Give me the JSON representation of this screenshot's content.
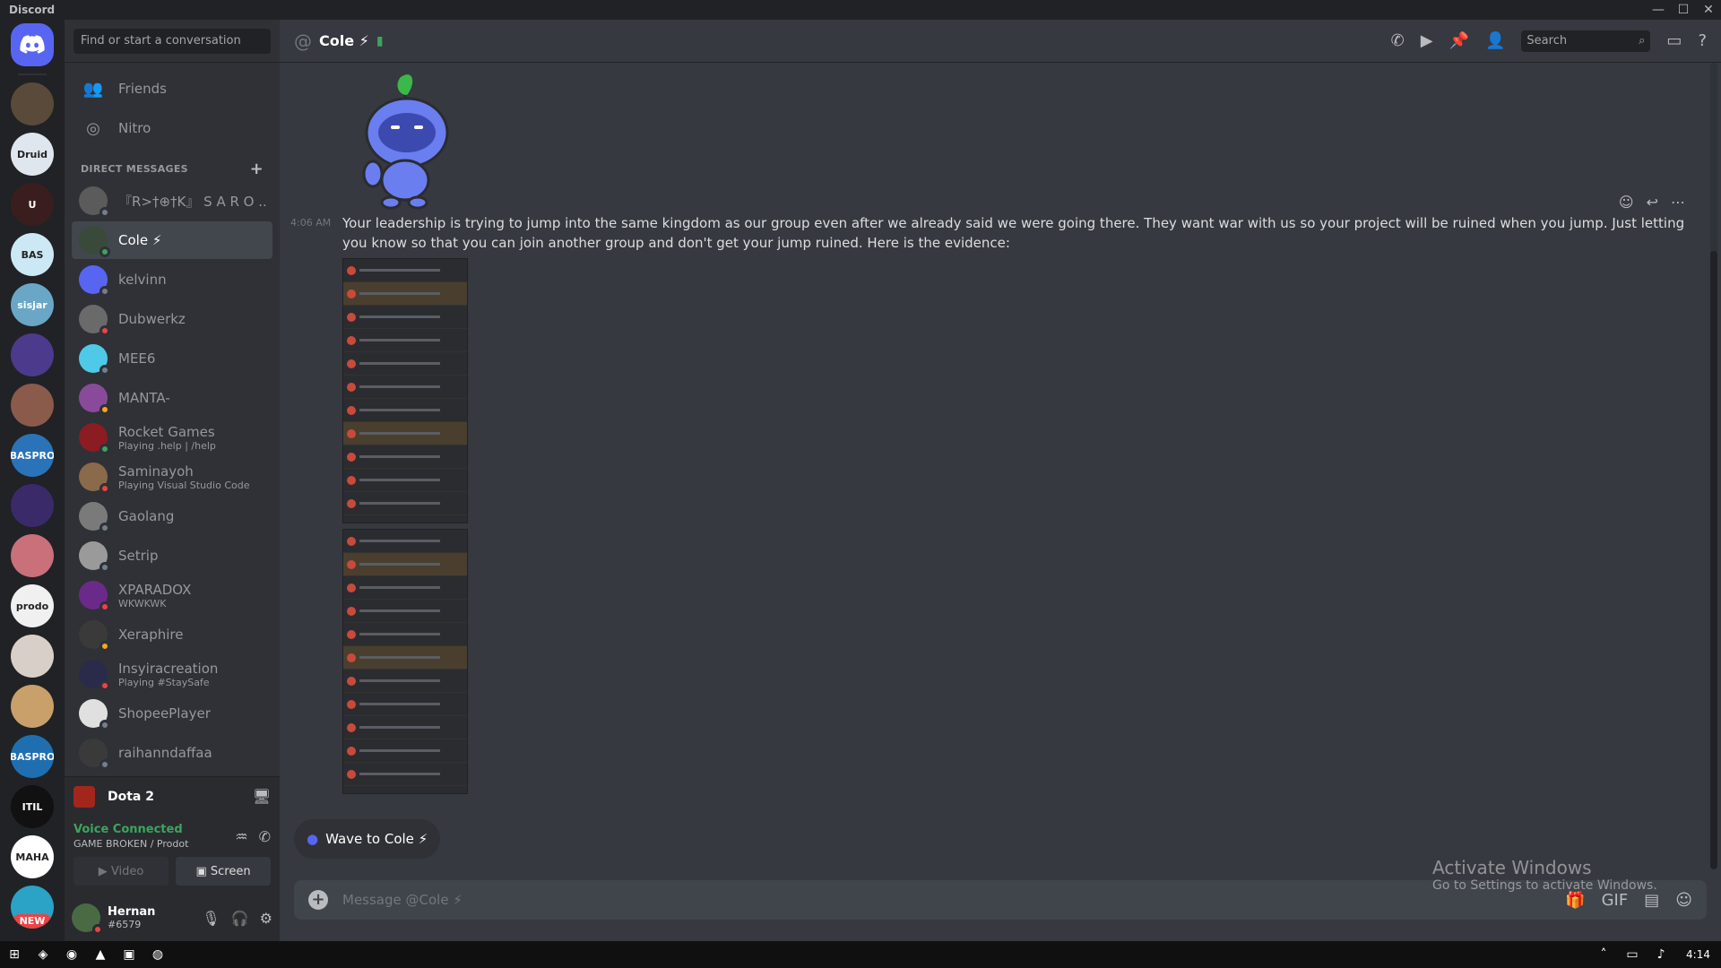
{
  "window": {
    "title": "Discord"
  },
  "guilds": [
    {
      "label": "",
      "color": "#5a4a3a"
    },
    {
      "label": "Druid",
      "color": "#dfe6ee"
    },
    {
      "label": "U",
      "color": "#3a1e1e"
    },
    {
      "label": "BAS",
      "color": "#cde8f5"
    },
    {
      "label": "sisjar",
      "color": "#6aa6c6"
    },
    {
      "label": "",
      "color": "#4c3a8c"
    },
    {
      "label": "",
      "color": "#8a5a4a"
    },
    {
      "label": "BASPRO",
      "color": "#2a73b8"
    },
    {
      "label": "",
      "color": "#3a2a6a"
    },
    {
      "label": "",
      "color": "#c9707a"
    },
    {
      "label": "prodo",
      "color": "#f0f0f0"
    },
    {
      "label": "",
      "color": "#d8d0c8"
    },
    {
      "label": "",
      "color": "#c9a06a"
    },
    {
      "label": "BASPRO",
      "color": "#1f6fb0"
    },
    {
      "label": "ITIL",
      "color": "#111111"
    },
    {
      "label": "MAHA",
      "color": "#ffffff"
    },
    {
      "label": "NEW",
      "color": "#2aa3c7"
    }
  ],
  "sidebar": {
    "search_placeholder": "Find or start a conversation",
    "nav": [
      {
        "label": "Friends",
        "icon": "friends-icon"
      },
      {
        "label": "Nitro",
        "icon": "nitro-icon"
      }
    ],
    "dm_header": "DIRECT MESSAGES",
    "dms": [
      {
        "name": "『R>†⊕†K』 S A R O ...",
        "sub": "",
        "color": "#5b5b5b",
        "status": "#747f8d"
      },
      {
        "name": "Cole ⚡",
        "sub": "",
        "color": "#3a4a3a",
        "status": "#3ba55d",
        "active": true
      },
      {
        "name": "kelvinn",
        "sub": "",
        "color": "#5865f2",
        "status": "#747f8d"
      },
      {
        "name": "Dubwerkz",
        "sub": "",
        "color": "#6a6a6a",
        "status": "#ed4245"
      },
      {
        "name": "MEE6",
        "sub": "",
        "color": "#4ec9e8",
        "status": "#747f8d"
      },
      {
        "name": "MANTA-",
        "sub": "",
        "color": "#8a4a9a",
        "status": "#faa61a"
      },
      {
        "name": "Rocket Games",
        "sub": "Playing .help | /help",
        "color": "#8a1c22",
        "status": "#3ba55d"
      },
      {
        "name": "Saminayoh",
        "sub": "Playing Visual Studio Code",
        "color": "#8a6a4a",
        "status": "#ed4245"
      },
      {
        "name": "Gaolang",
        "sub": "",
        "color": "#7a7a7a",
        "status": "#747f8d"
      },
      {
        "name": "Setrip",
        "sub": "",
        "color": "#9a9a9a",
        "status": "#747f8d"
      },
      {
        "name": "XPARADOX",
        "sub": "WKWKWK",
        "color": "#6a2a8a",
        "status": "#ed4245"
      },
      {
        "name": "Xeraphire",
        "sub": "",
        "color": "#3a3a3a",
        "status": "#faa61a"
      },
      {
        "name": "Insyiracreation",
        "sub": "Playing #StaySafe",
        "color": "#2a2a4a",
        "status": "#ed4245"
      },
      {
        "name": "ShopeePlayer",
        "sub": "",
        "color": "#e0e0e0",
        "status": "#747f8d"
      },
      {
        "name": "raihanndaffaa",
        "sub": "",
        "color": "#3a3a3a",
        "status": "#747f8d"
      }
    ],
    "activity": {
      "game": "Dota 2"
    },
    "voice": {
      "status": "Voice Connected",
      "channel": "GAME BROKEN / Prodot",
      "video_label": "Video",
      "screen_label": "Screen"
    },
    "user": {
      "name": "Hernan",
      "tag": "#6579"
    }
  },
  "header": {
    "title": "Cole ⚡",
    "search_placeholder": "Search"
  },
  "chat": {
    "message": {
      "time": "4:06 AM",
      "text": "Your leadership is trying to jump into the same kingdom as our group even after we already said we were going there. They want war with us so your project will be ruined when you jump. Just letting you know so that you can join another group and don't get your jump ruined. Here is the evidence:"
    },
    "wave_label": "Wave to Cole ⚡",
    "composer_placeholder": "Message @Cole ⚡"
  },
  "watermark": {
    "line1": "Activate Windows",
    "line2": "Go to Settings to activate Windows."
  },
  "taskbar": {
    "time": "4:14"
  }
}
